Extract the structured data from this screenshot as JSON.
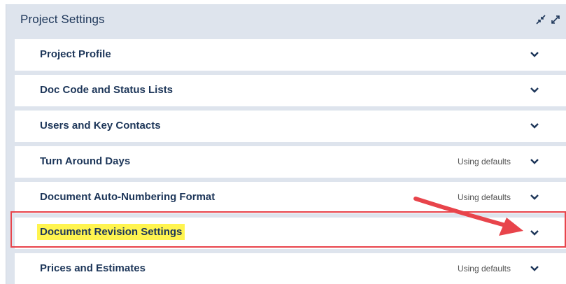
{
  "panel": {
    "title": "Project Settings",
    "collapse_icon": "collapse-all-icon",
    "expand_icon": "expand-all-icon"
  },
  "sections": [
    {
      "label": "Project Profile",
      "status": "",
      "chevron_icon": "chevron-down-icon"
    },
    {
      "label": "Doc Code and Status Lists",
      "status": "",
      "chevron_icon": "chevron-down-icon"
    },
    {
      "label": "Users and Key Contacts",
      "status": "",
      "chevron_icon": "chevron-down-icon"
    },
    {
      "label": "Turn Around Days",
      "status": "Using defaults",
      "chevron_icon": "chevron-down-icon"
    },
    {
      "label": "Document Auto-Numbering Format",
      "status": "Using defaults",
      "chevron_icon": "chevron-down-icon"
    },
    {
      "label": "Document Revision Settings",
      "status": "",
      "chevron_icon": "chevron-down-icon",
      "highlighted": true
    },
    {
      "label": "Prices and Estimates",
      "status": "Using defaults",
      "chevron_icon": "chevron-down-icon"
    }
  ],
  "colors": {
    "panel_bg": "#dee4ed",
    "title_text": "#1d3659",
    "highlight": "#fff44f",
    "annotation": "#e8444b"
  }
}
